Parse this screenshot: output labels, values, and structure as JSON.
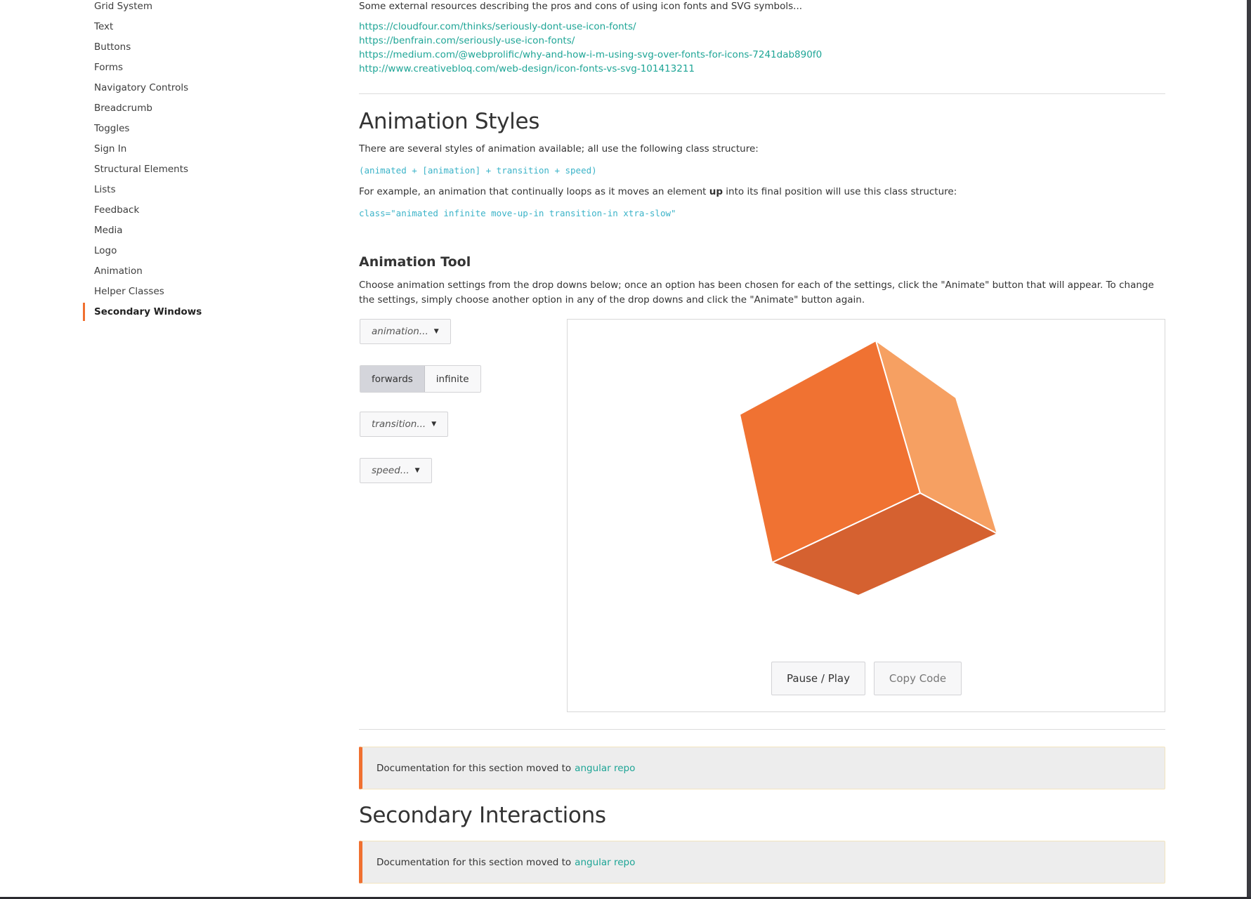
{
  "sidebar": {
    "items": [
      {
        "label": "Grid System"
      },
      {
        "label": "Text"
      },
      {
        "label": "Buttons"
      },
      {
        "label": "Forms"
      },
      {
        "label": "Navigatory Controls"
      },
      {
        "label": "Breadcrumb"
      },
      {
        "label": "Toggles"
      },
      {
        "label": "Sign In"
      },
      {
        "label": "Structural Elements"
      },
      {
        "label": "Lists"
      },
      {
        "label": "Feedback"
      },
      {
        "label": "Media"
      },
      {
        "label": "Logo"
      },
      {
        "label": "Animation"
      },
      {
        "label": "Helper Classes"
      },
      {
        "label": "Secondary Windows",
        "active": true
      }
    ]
  },
  "resources": {
    "intro": "Some external resources describing the pros and cons of using icon fonts and SVG symbols...",
    "links": [
      "https://cloudfour.com/thinks/seriously-dont-use-icon-fonts/",
      "https://benfrain.com/seriously-use-icon-fonts/",
      "https://medium.com/@webprolific/why-and-how-i-m-using-svg-over-fonts-for-icons-7241dab890f0",
      "http://www.creativebloq.com/web-design/icon-fonts-vs-svg-101413211"
    ]
  },
  "animation_styles": {
    "title": "Animation Styles",
    "intro": "There are several styles of animation available; all use the following class structure:",
    "structure_code": "(animated + [animation] + transition + speed)",
    "example_before": "For example, an animation that continually loops as it moves an element ",
    "example_bold": "up",
    "example_after": " into its final position will use this class structure:",
    "example_code": "class=\"animated infinite move-up-in transition-in xtra-slow\""
  },
  "animation_tool": {
    "title": "Animation Tool",
    "description": "Choose animation settings from the drop downs below; once an option has been chosen for each of the settings, click the \"Animate\" button that will appear. To change the settings, simply choose another option in any of the drop downs and click the \"Animate\" button again.",
    "animation_dropdown": "animation...",
    "fill_mode": {
      "options": [
        "forwards",
        "infinite"
      ],
      "selected": "forwards"
    },
    "transition_dropdown": "transition...",
    "speed_dropdown": "speed...",
    "pause_play_label": "Pause / Play",
    "copy_code_label": "Copy Code",
    "cube_colors": {
      "front": "#f07232",
      "side": "#f6a062",
      "bottom": "#d56130"
    }
  },
  "notices": [
    {
      "text": "Documentation for this section moved to",
      "link": "angular repo"
    },
    {
      "text": "Documentation for this section moved to",
      "link": "angular repo"
    }
  ],
  "secondary_interactions": {
    "title": "Secondary Interactions"
  },
  "colors": {
    "accent": "#f07030",
    "link": "#1ea596",
    "code": "#3bb3c8"
  }
}
